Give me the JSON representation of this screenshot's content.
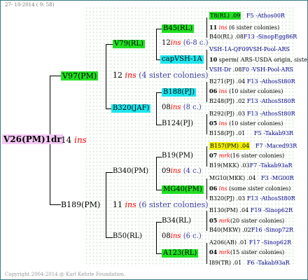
{
  "header": {
    "date": "27- 10-2014 ( 9: 58)"
  },
  "footer": {
    "copyright": "Copyright 2004-2014 @ Karl Kehrle Foundation."
  },
  "root": {
    "name": "V26(PM)1dr",
    "ins": "14",
    "ins_word": "ins"
  },
  "gen1": [
    {
      "name": "V97(PM)",
      "ins": "12",
      "ins_word": "ins",
      "sis": "(4 sister colonies)"
    },
    {
      "name": "B189(PM)",
      "ins": "11",
      "ins_word": "ins",
      "sis": "(6 sister colonies)"
    }
  ],
  "gen2": [
    {
      "name": "V79(RL)",
      "ins": "12",
      "ins_word": "ins",
      "sis": "(6-8 c.)"
    },
    {
      "name": "B320(JAF)",
      "ins": "08",
      "ins_word": "ins",
      "sis": "(8 c.)"
    },
    {
      "name": "B340(PM)",
      "ins": "09",
      "ins_word": "ins",
      "sis": "(4 c.)"
    },
    {
      "name": "B50(RL)",
      "ins": "08",
      "ins_word": "ins",
      "sis": "(6 c.)"
    }
  ],
  "gen3": [
    {
      "name": "B45(RL)",
      "ins": "11",
      "ins_word": "ins",
      "sis": "(6 sister colonies)"
    },
    {
      "name": "capVSH-1A",
      "ins": "10",
      "ins_word": "sperm",
      "sis": "( ARS-USDA origin, sister colonies)"
    },
    {
      "name": "B188(PJ)",
      "ins": "06",
      "ins_word": "ins",
      "sis": "(10 sister colonies)"
    },
    {
      "name": "B124(PJ)",
      "ins": "05",
      "ins_word": "ins",
      "sis": "(10 sister colonies)"
    },
    {
      "name": "B19(PM)",
      "ins": "07",
      "ins_word": "mrk",
      "sis": "(16 sister colonies)"
    },
    {
      "name": "MG40(PM)",
      "ins": "06",
      "ins_word": "ins",
      "sis": "(some sister colonies)"
    },
    {
      "name": "B34(RL)",
      "ins": "05",
      "ins_word": "mrk",
      "sis": "(20 sister colonies)"
    },
    {
      "name": "A123(RL)",
      "ins": "04",
      "ins_word": "mrk",
      "sis": "(15 sister colonies)"
    }
  ],
  "gen4": [
    {
      "name": "T8(RL)",
      "year": ".09",
      "info": "F5 -Athos00R"
    },
    {
      "name": "B40(RL)",
      "year": ".08",
      "info": "F13 -SinopEgg86R"
    },
    {
      "name": "VSH-1A-QF09",
      "year": "",
      "info": "VSH-Pool-ARS"
    },
    {
      "name": "VSH-Dr",
      "year": ".08",
      "info": "F0 -VSH-Pool-ARS"
    },
    {
      "name": "B271(PJ)",
      "year": ".04",
      "info": "F13 -AthosSt80R"
    },
    {
      "name": "B248(PJ)",
      "year": ".02",
      "info": "F13 -AthosSt80R"
    },
    {
      "name": "B292(PJ)",
      "year": ".03",
      "info": "F13 -AthosSt80R"
    },
    {
      "name": "B158(PJ)",
      "year": ".01",
      "info": "F5 -Takab93R"
    },
    {
      "name": "B157(PM)",
      "year": ".04",
      "info": "F7 -Maced93R"
    },
    {
      "name": "B19(MKK)",
      "year": ".03",
      "info": "F7 -Takab93aR"
    },
    {
      "name": "MG10(MKK)",
      "year": ".04",
      "info": "F3 -MG00R"
    },
    {
      "name": "B320(PJ)",
      "year": ".03",
      "info": "F13 -AthosSt80R"
    },
    {
      "name": "B130(PM)",
      "year": ".04",
      "info": "F19 -Sinop62R"
    },
    {
      "name": "B40(MKW)",
      "year": ".02",
      "info": "F16 -Sinop72R"
    },
    {
      "name": "A206(AB)",
      "year": ".01",
      "info": "F17 -Sinop62R"
    },
    {
      "name": "I89(TR)",
      "year": ".01",
      "info": "F6 -Takab93aR"
    }
  ],
  "colors": {
    "green": "#22e022",
    "cyan": "#1ee6ee",
    "yellow": "#f0f000",
    "pink": "#f4c8f4",
    "ins_red": "#ff0000",
    "link_blue": "#00008b"
  }
}
